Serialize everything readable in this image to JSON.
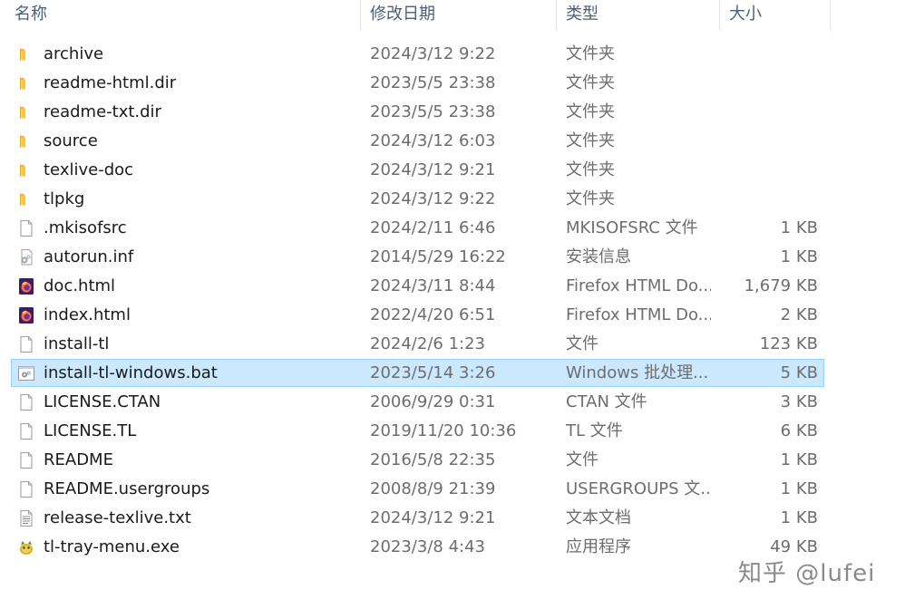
{
  "columns": {
    "name": "名称",
    "date": "修改日期",
    "type": "类型",
    "size": "大小"
  },
  "files": [
    {
      "name": "archive",
      "date": "2024/3/12 9:22",
      "type": "文件夹",
      "size": "",
      "icon": "folder-icon"
    },
    {
      "name": "readme-html.dir",
      "date": "2023/5/5 23:38",
      "type": "文件夹",
      "size": "",
      "icon": "folder-icon"
    },
    {
      "name": "readme-txt.dir",
      "date": "2023/5/5 23:38",
      "type": "文件夹",
      "size": "",
      "icon": "folder-icon"
    },
    {
      "name": "source",
      "date": "2024/3/12 6:03",
      "type": "文件夹",
      "size": "",
      "icon": "folder-icon"
    },
    {
      "name": "texlive-doc",
      "date": "2024/3/12 9:21",
      "type": "文件夹",
      "size": "",
      "icon": "folder-icon"
    },
    {
      "name": "tlpkg",
      "date": "2024/3/12 9:22",
      "type": "文件夹",
      "size": "",
      "icon": "folder-icon"
    },
    {
      "name": ".mkisofsrc",
      "date": "2024/2/11 6:46",
      "type": "MKISOFSRC 文件",
      "size": "1 KB",
      "icon": "file-icon"
    },
    {
      "name": "autorun.inf",
      "date": "2014/5/29 16:22",
      "type": "安装信息",
      "size": "1 KB",
      "icon": "setup-info-icon"
    },
    {
      "name": "doc.html",
      "date": "2024/3/11 8:44",
      "type": "Firefox HTML Do...",
      "size": "1,679 KB",
      "icon": "firefox-icon"
    },
    {
      "name": "index.html",
      "date": "2022/4/20 6:51",
      "type": "Firefox HTML Do...",
      "size": "2 KB",
      "icon": "firefox-icon"
    },
    {
      "name": "install-tl",
      "date": "2024/2/6 1:23",
      "type": "文件",
      "size": "123 KB",
      "icon": "file-icon"
    },
    {
      "name": "install-tl-windows.bat",
      "date": "2023/5/14 3:26",
      "type": "Windows 批处理...",
      "size": "5 KB",
      "icon": "batch-file-icon",
      "selected": true
    },
    {
      "name": "LICENSE.CTAN",
      "date": "2006/9/29 0:31",
      "type": "CTAN 文件",
      "size": "3 KB",
      "icon": "file-icon"
    },
    {
      "name": "LICENSE.TL",
      "date": "2019/11/20 10:36",
      "type": "TL 文件",
      "size": "6 KB",
      "icon": "file-icon"
    },
    {
      "name": "README",
      "date": "2016/5/8 22:35",
      "type": "文件",
      "size": "1 KB",
      "icon": "file-icon"
    },
    {
      "name": "README.usergroups",
      "date": "2008/8/9 21:39",
      "type": "USERGROUPS 文...",
      "size": "1 KB",
      "icon": "file-icon"
    },
    {
      "name": "release-texlive.txt",
      "date": "2024/3/12 9:21",
      "type": "文本文档",
      "size": "1 KB",
      "icon": "text-document-icon"
    },
    {
      "name": "tl-tray-menu.exe",
      "date": "2023/3/8 4:43",
      "type": "应用程序",
      "size": "49 KB",
      "icon": "application-icon"
    }
  ],
  "watermark": "知乎 @lufei",
  "colors": {
    "selection_bg": "#cce8ff",
    "selection_border": "#99d1ff",
    "header_text": "#4c607a",
    "folder": "#f8c44f"
  }
}
